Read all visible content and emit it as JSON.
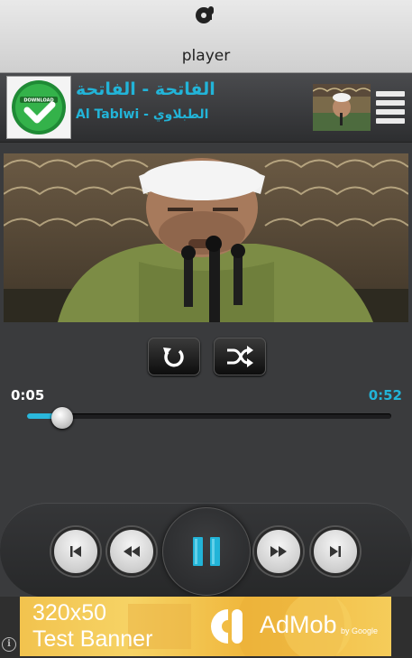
{
  "topbar": {
    "title": "player",
    "icon": "quran-recorder-icon"
  },
  "now_playing": {
    "title": "الفاتحة - الفاتحة",
    "subtitle": "Al Tablwi - الطبلاوي",
    "download_label": "DOWNLOAD",
    "accent_color": "#22b4d8"
  },
  "controls": {
    "repeat_icon": "repeat-icon",
    "shuffle_icon": "shuffle-icon"
  },
  "progress": {
    "current": "0:05",
    "total": "0:52",
    "fraction": 0.096
  },
  "transport": {
    "buttons": [
      "skip-previous-icon",
      "rewind-icon",
      "pause-icon",
      "fast-forward-icon",
      "skip-next-icon"
    ],
    "state": "playing"
  },
  "ad": {
    "size_text": "320x50",
    "label": "Test Banner",
    "brand": "AdMob",
    "by": "by Google"
  }
}
